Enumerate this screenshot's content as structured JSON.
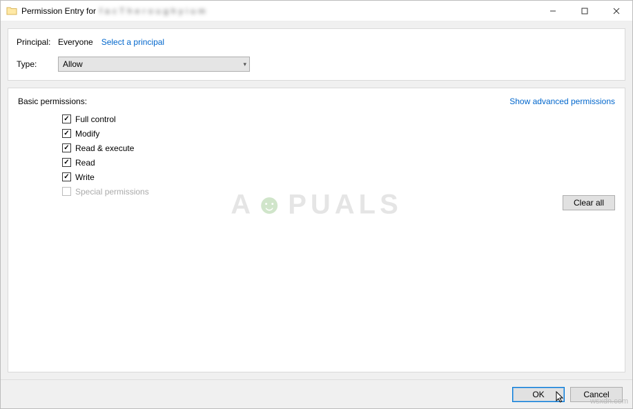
{
  "titlebar": {
    "title_prefix": "Permission Entry for",
    "title_obscured": "f a c T h e r o u g h y i u m"
  },
  "top_panel": {
    "principal_label": "Principal:",
    "principal_value": "Everyone",
    "select_principal_link": "Select a principal",
    "type_label": "Type:",
    "type_value": "Allow"
  },
  "perm_panel": {
    "header": "Basic permissions:",
    "advanced_link": "Show advanced permissions",
    "items": [
      {
        "label": "Full control",
        "checked": true,
        "disabled": false
      },
      {
        "label": "Modify",
        "checked": true,
        "disabled": false
      },
      {
        "label": "Read & execute",
        "checked": true,
        "disabled": false
      },
      {
        "label": "Read",
        "checked": true,
        "disabled": false
      },
      {
        "label": "Write",
        "checked": true,
        "disabled": false
      },
      {
        "label": "Special permissions",
        "checked": false,
        "disabled": true
      }
    ],
    "clear_all": "Clear all"
  },
  "footer": {
    "ok": "OK",
    "cancel": "Cancel"
  },
  "watermark": {
    "left": "A",
    "right": "PUALS"
  },
  "corner": "wsxdn.com"
}
